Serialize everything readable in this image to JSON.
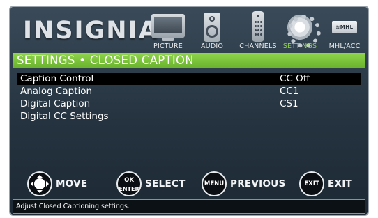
{
  "brand": "INSIGNIA",
  "tabs": [
    {
      "label": "PICTURE",
      "active": false,
      "icon": "tv-icon"
    },
    {
      "label": "AUDIO",
      "active": false,
      "icon": "speaker-icon"
    },
    {
      "label": "CHANNELS",
      "active": false,
      "icon": "remote-icon"
    },
    {
      "label": "SETTINGS",
      "active": true,
      "icon": "gear-icon"
    },
    {
      "label": "MHL/ACC",
      "active": false,
      "icon": "mhl-icon"
    }
  ],
  "mhl_logo": "≋MHL",
  "title": "SETTINGS • CLOSED CAPTION",
  "menu": [
    {
      "label": "Caption Control",
      "value": "CC Off",
      "selected": true
    },
    {
      "label": "Analog Caption",
      "value": "CC1"
    },
    {
      "label": "Digital Caption",
      "value": "CS1"
    },
    {
      "label": "Digital CC Settings",
      "value": ""
    }
  ],
  "hints": [
    {
      "key": "",
      "label": "MOVE",
      "icon": "dpad-icon"
    },
    {
      "key_top": "OK",
      "key_bottom": "ENTER",
      "label": "SELECT",
      "icon": "ok-enter-icon"
    },
    {
      "key": "MENU",
      "label": "PREVIOUS",
      "icon": "menu-icon"
    },
    {
      "key": "EXIT",
      "label": "EXIT",
      "icon": "exit-icon"
    }
  ],
  "status": "Adjust Closed Captioning settings.",
  "colors": {
    "accent_green": "#7cc63b",
    "active_tab_label": "#8dd14a",
    "background": "#253340",
    "selection": "#000000"
  }
}
